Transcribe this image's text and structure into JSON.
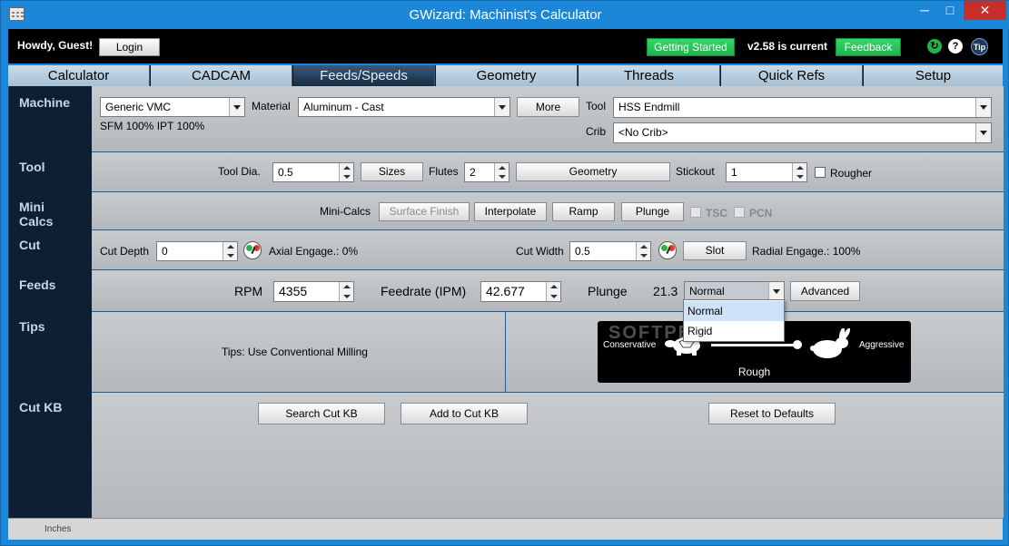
{
  "window": {
    "title": "GWizard: Machinist's Calculator",
    "minimize": "─",
    "maximize": "□",
    "close": "✕"
  },
  "header": {
    "greeting": "Howdy, Guest!",
    "login": "Login",
    "getting_started": "Getting Started",
    "version": "v2.58 is current",
    "feedback": "Feedback",
    "tip": "Tip",
    "help": "?"
  },
  "tabs": [
    "Calculator",
    "CADCAM",
    "Feeds/Speeds",
    "Geometry",
    "Threads",
    "Quick Refs",
    "Setup"
  ],
  "active_tab": "Feeds/Speeds",
  "machine": {
    "label": "Machine",
    "machine_value": "Generic VMC",
    "material_label": "Material",
    "material_value": "Aluminum - Cast",
    "more": "More",
    "tool_label": "Tool",
    "tool_value": "HSS Endmill",
    "crib_label": "Crib",
    "crib_value": "<No Crib>",
    "sfm_ipt": "SFM 100%  IPT 100%"
  },
  "tool": {
    "label": "Tool",
    "dia_label": "Tool Dia.",
    "dia_value": "0.5",
    "sizes": "Sizes",
    "flutes_label": "Flutes",
    "flutes_value": "2",
    "geometry": "Geometry",
    "stickout_label": "Stickout",
    "stickout_value": "1",
    "rougher": "Rougher"
  },
  "mini_calcs": {
    "label_line1": "Mini",
    "label_line2": "Calcs",
    "row_label": "Mini-Calcs",
    "surface_finish": "Surface Finish",
    "interpolate": "Interpolate",
    "ramp": "Ramp",
    "plunge": "Plunge",
    "tsc": "TSC",
    "pcn": "PCN"
  },
  "cut": {
    "label": "Cut",
    "depth_label": "Cut Depth",
    "depth_value": "0",
    "axial": "Axial Engage.: 0%",
    "width_label": "Cut Width",
    "width_value": "0.5",
    "slot": "Slot",
    "radial": "Radial Engage.: 100%"
  },
  "feeds": {
    "label": "Feeds",
    "rpm_label": "RPM",
    "rpm_value": "4355",
    "feedrate_label": "Feedrate (IPM)",
    "feedrate_value": "42.677",
    "plunge_label": "Plunge",
    "plunge_value": "21.3",
    "mode_value": "Normal",
    "mode_options": [
      "Normal",
      "Rigid"
    ],
    "advanced": "Advanced"
  },
  "tips": {
    "label": "Tips",
    "text": "Tips:  Use Conventional Milling",
    "conservative": "Conservative",
    "aggressive": "Aggressive",
    "mode": "Rough",
    "watermark": "SOFTPEDIA"
  },
  "cutkb": {
    "label": "Cut KB",
    "search": "Search Cut KB",
    "add": "Add to Cut KB",
    "reset": "Reset to Defaults"
  },
  "status": {
    "units": "Inches"
  },
  "colors": {
    "title_bar": "#1c86d9",
    "sidebar": "#0e1f33",
    "active_tab": "#152c43",
    "green_button": "#1fb24c",
    "close_button": "#c7302a"
  }
}
